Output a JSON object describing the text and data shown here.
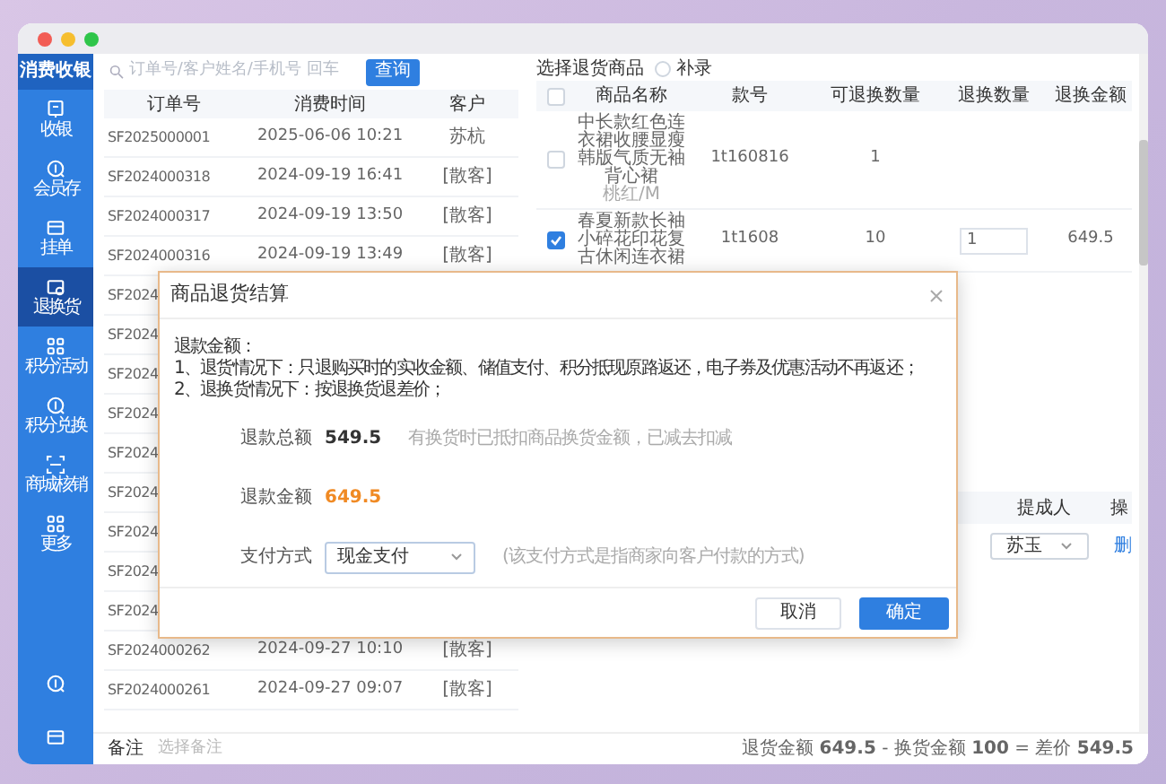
{
  "app": {
    "logo": "消费收银"
  },
  "sidebar": {
    "items": [
      {
        "label": "收银",
        "selected": false
      },
      {
        "label": "会员存",
        "selected": false
      },
      {
        "label": "挂单",
        "selected": false
      },
      {
        "label": "退换货",
        "selected": true
      },
      {
        "label": "积分活动",
        "selected": false
      },
      {
        "label": "积分兑换",
        "selected": false
      },
      {
        "label": "商城核销",
        "selected": false
      },
      {
        "label": "更多",
        "selected": false
      }
    ]
  },
  "search": {
    "placeholder": "订单号/客户姓名/手机号 回车",
    "button": "查询"
  },
  "orders": {
    "columns": [
      "订单号",
      "消费时间",
      "客户"
    ],
    "rows": [
      {
        "id": "SF2025000001",
        "time": "2025-06-06 10:21",
        "customer": "苏杭"
      },
      {
        "id": "SF2024000318",
        "time": "2024-09-19 16:41",
        "customer": "[散客]"
      },
      {
        "id": "SF2024000317",
        "time": "2024-09-19 13:50",
        "customer": "[散客]"
      },
      {
        "id": "SF2024000316",
        "time": "2024-09-19 13:49",
        "customer": "[散客]"
      },
      {
        "id": "SF2024"
      },
      {
        "id": "SF2024"
      },
      {
        "id": "SF2024"
      },
      {
        "id": "SF2024"
      },
      {
        "id": "SF2024"
      },
      {
        "id": "SF2024"
      },
      {
        "id": "SF2024"
      },
      {
        "id": "SF2024"
      },
      {
        "id": "SF2024"
      },
      {
        "id": "SF2024000262",
        "time": "2024-09-27 10:10",
        "customer": "[散客]"
      },
      {
        "id": "SF2024000261",
        "time": "2024-09-27 09:07",
        "customer": "[散客]"
      }
    ]
  },
  "return_goods": {
    "title": "选择退货商品",
    "option": {
      "label": "补录",
      "checked": false
    },
    "all_checked": false,
    "columns": [
      "商品名称",
      "款号",
      "可退换数量",
      "退换数量",
      "退换金额"
    ],
    "rows": [
      {
        "checked": false,
        "name": "中长款红色连衣裙收腰显瘦韩版气质无袖背心裙",
        "spec": "桃红/M",
        "code": "1t160816",
        "available": "1"
      },
      {
        "checked": true,
        "name": "春夏新款长袖小碎花印花复古休闲连衣裙",
        "code": "1t1608",
        "available": "10",
        "quantity": "1",
        "amount": "649.5"
      }
    ]
  },
  "staff": {
    "columns": [
      "提成人",
      "操"
    ],
    "person": "苏玉",
    "link": "删"
  },
  "footer": {
    "remark_label": "备注",
    "remark_placeholder": "选择备注",
    "summary": "退货金额 **649.5** - 换货金额 **100** = 差价 **549.5**"
  },
  "dialog": {
    "title": "商品退货结算",
    "notes": [
      "退款金额：",
      "1、退货情况下：只退购买时的实收金额、储值支付、积分抵现原路返还，电子券及优惠活动不再返还；",
      "2、退换货情况下：按退换货退差价；"
    ],
    "fields": [
      {
        "kind": "total",
        "label": "退款总额",
        "value": "549.5",
        "hint": "有换货时已抵扣商品换货金额，已减去扣减"
      },
      {
        "kind": "refund",
        "label": "退款金额",
        "value": "649.5"
      },
      {
        "kind": "select",
        "label": "支付方式",
        "value": "现金支付",
        "hint": "(该支付方式是指商家向客户付款的方式)"
      }
    ],
    "cancel": "取消",
    "confirm": "确定"
  }
}
